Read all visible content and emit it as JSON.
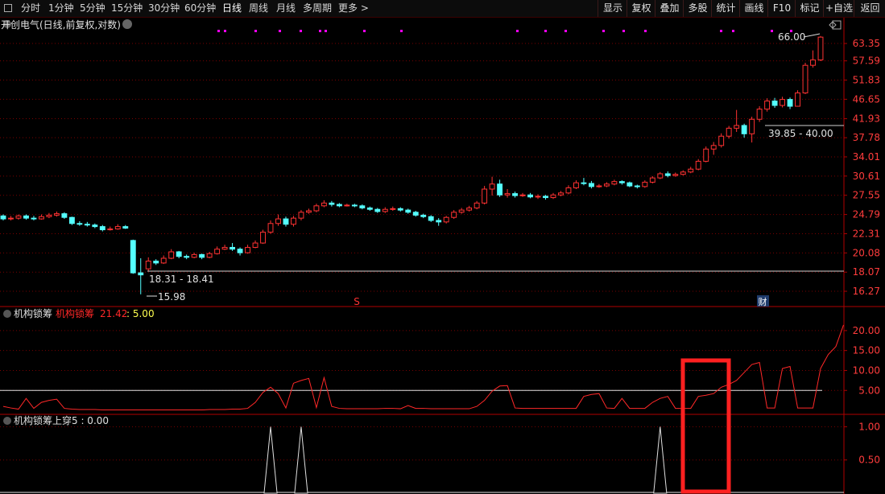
{
  "toolbar": {
    "periods": [
      "分时",
      "1分钟",
      "5分钟",
      "15分钟",
      "30分钟",
      "60分钟",
      "日线",
      "周线",
      "月线",
      "多周期",
      "更多"
    ],
    "active_period": "日线",
    "right_buttons": [
      "显示",
      "复权",
      "叠加",
      "多股",
      "统计",
      "画线",
      "F10",
      "标记",
      "+自选",
      "返回"
    ]
  },
  "main_panel": {
    "stock_name": "开创电气",
    "mode": "(日线,前复权,对数)",
    "price_ticks": [
      "63.35",
      "57.59",
      "51.83",
      "46.65",
      "41.93",
      "37.78",
      "34.01",
      "30.61",
      "27.55",
      "24.79",
      "22.31",
      "20.08",
      "18.07",
      "16.27"
    ],
    "annotations": {
      "high": "66.00",
      "low": "15.98",
      "range_low": "18.31 - 18.41",
      "range_high": "39.85 - 40.00",
      "marker_s": "S",
      "marker_cai": "财"
    }
  },
  "indicator1": {
    "name": "机构锁筹",
    "line_name": "机构锁筹",
    "line_value": "21.42",
    "threshold_value": "5.00",
    "ticks": [
      "20.00",
      "15.00",
      "10.00",
      "5.00"
    ]
  },
  "indicator2": {
    "label": "机构锁筹上穿5 : 0.00",
    "ticks": [
      "1.00",
      "0.50"
    ]
  },
  "colors": {
    "up": "#ff3232",
    "down": "#54ffff",
    "grid": "#7a0000",
    "magenta": "#ff00ff",
    "highlight": "#ff2020"
  },
  "chart_data": {
    "type": "candlestick",
    "scale": "log",
    "ylim": [
      15.5,
      68
    ],
    "candles": [
      [
        24.6,
        24.2,
        24.8,
        24.0
      ],
      [
        24.2,
        24.3,
        24.6,
        24.0
      ],
      [
        24.3,
        24.6,
        24.8,
        24.1
      ],
      [
        24.6,
        24.3,
        24.8,
        24.1
      ],
      [
        24.3,
        24.2,
        24.6,
        24.0
      ],
      [
        24.2,
        24.5,
        24.8,
        24.1
      ],
      [
        24.5,
        24.7,
        25.0,
        24.3
      ],
      [
        24.7,
        24.9,
        25.2,
        24.5
      ],
      [
        24.9,
        24.4,
        25.1,
        24.2
      ],
      [
        24.4,
        23.6,
        24.5,
        23.4
      ],
      [
        23.6,
        23.5,
        23.9,
        23.3
      ],
      [
        23.5,
        23.4,
        23.8,
        23.2
      ],
      [
        23.4,
        23.2,
        23.6,
        23.0
      ],
      [
        23.2,
        22.8,
        23.4,
        22.6
      ],
      [
        22.8,
        22.9,
        23.2,
        22.7
      ],
      [
        22.9,
        23.2,
        23.5,
        22.8
      ],
      [
        23.2,
        23.0,
        23.4,
        22.9
      ],
      [
        21.5,
        18.0,
        21.6,
        17.9
      ],
      [
        18.0,
        17.8,
        19.5,
        16.0
      ],
      [
        18.4,
        19.2,
        19.6,
        18.2
      ],
      [
        19.2,
        19.0,
        19.4,
        18.8
      ],
      [
        19.0,
        19.5,
        19.8,
        18.9
      ],
      [
        19.5,
        20.2,
        20.5,
        19.4
      ],
      [
        20.2,
        19.7,
        20.3,
        19.5
      ],
      [
        19.7,
        19.6,
        19.9,
        19.4
      ],
      [
        19.6,
        19.9,
        20.1,
        19.5
      ],
      [
        19.9,
        19.6,
        20.0,
        19.4
      ],
      [
        19.6,
        20.0,
        20.2,
        19.5
      ],
      [
        20.0,
        20.5,
        20.8,
        19.9
      ],
      [
        20.5,
        20.7,
        21.0,
        20.4
      ],
      [
        20.7,
        20.5,
        21.2,
        20.3
      ],
      [
        20.5,
        20.1,
        20.7,
        19.8
      ],
      [
        20.1,
        20.7,
        21.0,
        20.0
      ],
      [
        20.7,
        21.2,
        21.5,
        20.6
      ],
      [
        21.2,
        22.5,
        22.8,
        21.1
      ],
      [
        22.5,
        23.6,
        24.0,
        22.3
      ],
      [
        23.6,
        24.2,
        24.8,
        23.3
      ],
      [
        24.2,
        23.5,
        24.5,
        23.2
      ],
      [
        23.5,
        24.3,
        24.6,
        23.2
      ],
      [
        24.3,
        25.1,
        25.4,
        24.0
      ],
      [
        25.1,
        25.3,
        25.6,
        24.9
      ],
      [
        25.3,
        26.0,
        26.3,
        25.1
      ],
      [
        26.0,
        26.4,
        26.8,
        25.8
      ],
      [
        26.4,
        26.2,
        26.7,
        25.9
      ],
      [
        26.2,
        26.0,
        26.4,
        25.8
      ],
      [
        26.0,
        26.1,
        26.3,
        25.9
      ],
      [
        26.1,
        26.0,
        26.3,
        25.8
      ],
      [
        26.0,
        25.7,
        26.2,
        25.5
      ],
      [
        25.7,
        25.5,
        25.9,
        25.3
      ],
      [
        25.5,
        25.2,
        25.7,
        25.0
      ],
      [
        25.2,
        25.5,
        25.8,
        25.0
      ],
      [
        25.5,
        25.6,
        25.9,
        25.3
      ],
      [
        25.6,
        25.4,
        25.8,
        25.2
      ],
      [
        25.4,
        25.1,
        25.6,
        24.9
      ],
      [
        25.1,
        24.7,
        25.3,
        24.5
      ],
      [
        24.7,
        24.5,
        24.9,
        24.3
      ],
      [
        24.5,
        24.0,
        24.7,
        23.8
      ],
      [
        24.0,
        23.8,
        24.3,
        23.3
      ],
      [
        23.8,
        24.4,
        24.6,
        23.6
      ],
      [
        24.4,
        25.1,
        25.4,
        24.2
      ],
      [
        25.1,
        25.4,
        25.7,
        24.9
      ],
      [
        25.4,
        25.7,
        26.0,
        25.2
      ],
      [
        25.7,
        26.4,
        26.7,
        25.5
      ],
      [
        26.4,
        28.5,
        29.0,
        26.2
      ],
      [
        28.5,
        29.3,
        30.5,
        27.5
      ],
      [
        29.3,
        27.6,
        30.0,
        27.3
      ],
      [
        27.6,
        27.8,
        28.5,
        27.2
      ],
      [
        27.8,
        27.5,
        28.1,
        27.2
      ],
      [
        27.5,
        27.6,
        27.9,
        27.3
      ],
      [
        27.6,
        27.3,
        27.9,
        27.1
      ],
      [
        27.3,
        27.4,
        27.7,
        27.0
      ],
      [
        27.4,
        27.2,
        27.6,
        26.9
      ],
      [
        27.2,
        27.6,
        27.9,
        27.0
      ],
      [
        27.6,
        27.9,
        28.2,
        27.4
      ],
      [
        27.9,
        28.7,
        29.1,
        27.7
      ],
      [
        28.7,
        29.5,
        29.9,
        28.5
      ],
      [
        29.5,
        29.4,
        30.3,
        29.1
      ],
      [
        29.4,
        28.9,
        29.8,
        28.6
      ],
      [
        28.9,
        29.0,
        29.3,
        28.7
      ],
      [
        29.0,
        29.3,
        29.6,
        28.8
      ],
      [
        29.3,
        29.7,
        30.0,
        29.1
      ],
      [
        29.7,
        29.5,
        29.9,
        29.2
      ],
      [
        29.5,
        29.0,
        29.7,
        28.8
      ],
      [
        29.0,
        28.9,
        29.2,
        28.6
      ],
      [
        28.9,
        29.6,
        29.9,
        28.7
      ],
      [
        29.6,
        30.3,
        30.6,
        29.4
      ],
      [
        30.3,
        31.0,
        31.3,
        30.1
      ],
      [
        31.0,
        30.7,
        31.4,
        30.4
      ],
      [
        30.7,
        30.9,
        31.2,
        30.5
      ],
      [
        30.9,
        31.3,
        31.6,
        30.7
      ],
      [
        31.3,
        31.8,
        32.2,
        31.1
      ],
      [
        31.8,
        33.2,
        33.6,
        31.6
      ],
      [
        33.2,
        35.5,
        36.0,
        33.0
      ],
      [
        35.5,
        36.2,
        36.9,
        34.4
      ],
      [
        36.2,
        38.1,
        38.7,
        35.8
      ],
      [
        38.1,
        39.8,
        40.3,
        37.6
      ],
      [
        39.8,
        40.4,
        44.0,
        39.0
      ],
      [
        40.4,
        38.6,
        40.8,
        37.8
      ],
      [
        38.6,
        41.8,
        42.4,
        36.8
      ],
      [
        41.8,
        44.2,
        44.9,
        41.2
      ],
      [
        44.2,
        46.2,
        46.9,
        43.6
      ],
      [
        46.2,
        45.1,
        47.0,
        44.5
      ],
      [
        45.1,
        46.6,
        47.3,
        44.6
      ],
      [
        46.6,
        44.9,
        47.1,
        44.2
      ],
      [
        44.9,
        48.3,
        49.0,
        44.8
      ],
      [
        48.3,
        56.2,
        57.0,
        48.0
      ],
      [
        56.2,
        57.9,
        61.0,
        55.5
      ],
      [
        57.9,
        65.6,
        66.0,
        57.5
      ]
    ],
    "indicator_values": [
      1.0,
      0.6,
      0.3,
      3.0,
      0.5,
      2.0,
      2.5,
      2.8,
      0.5,
      0.3,
      0.2,
      0.2,
      0.2,
      0.1,
      0.1,
      0.1,
      0.1,
      0.1,
      0.1,
      0.1,
      0.1,
      0.1,
      0.1,
      0.1,
      0.1,
      0.1,
      0.1,
      0.2,
      0.2,
      0.2,
      0.3,
      0.3,
      0.5,
      2.0,
      4.5,
      5.8,
      4.2,
      0.6,
      6.8,
      7.5,
      8.0,
      0.7,
      8.2,
      1.0,
      0.5,
      0.4,
      0.4,
      0.4,
      0.4,
      0.4,
      0.5,
      0.5,
      0.4,
      1.2,
      0.5,
      0.5,
      0.4,
      0.4,
      0.4,
      0.4,
      0.4,
      0.4,
      1.0,
      2.5,
      4.8,
      6.1,
      6.2,
      0.6,
      0.5,
      0.5,
      0.5,
      0.5,
      0.5,
      0.5,
      0.5,
      0.5,
      3.5,
      4.0,
      4.2,
      0.6,
      0.5,
      3.0,
      0.5,
      0.5,
      0.5,
      2.0,
      3.0,
      3.5,
      0.5,
      0.5,
      0.5,
      3.5,
      3.8,
      4.2,
      5.8,
      6.5,
      7.5,
      9.5,
      11.5,
      12.0,
      0.6,
      0.6,
      10.5,
      11.0,
      0.6,
      0.6,
      0.6,
      10.5,
      14.0,
      16.0,
      21.4
    ],
    "threshold": 5.0,
    "indicator_ylim": [
      -1,
      23
    ],
    "signal_indices": [
      35,
      39,
      86
    ],
    "signal_ylim": [
      0,
      1.15
    ]
  }
}
